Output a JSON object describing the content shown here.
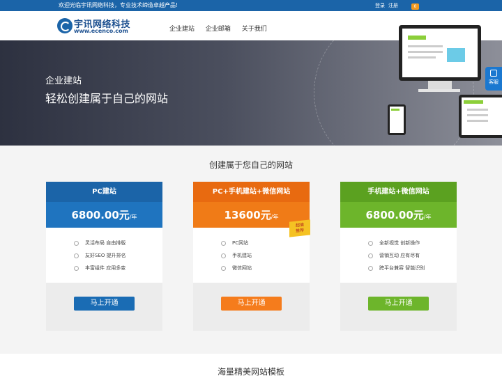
{
  "topbar": {
    "welcome": "欢迎光临宇讯网络科技，专业技术缔造卓越产品!",
    "login": "登录",
    "register": "注册",
    "cart_count": "0",
    "colors": {
      "bar": "#1b64a8",
      "cart": "#f39a1f"
    }
  },
  "header": {
    "logo_cn": "宇讯网络科技",
    "logo_en": "www.ecenco.com",
    "nav": [
      "企业建站",
      "企业邮箱",
      "关于我们"
    ]
  },
  "banner": {
    "subtitle": "企业建站",
    "title": "轻松创建属于自己的网站",
    "service_label": "客服"
  },
  "pricing": {
    "title": "创建属于您自己的网站",
    "badge": [
      "超值",
      "推荐"
    ],
    "plans": [
      {
        "name": "PC建站",
        "price": "6800.00",
        "currency": "元",
        "period": "/年",
        "features": [
          "灵活布局 自由排版",
          "友好SEO 提升排名",
          "丰富组件 应用多变"
        ],
        "button": "马上开通",
        "color": "#1b64a8"
      },
      {
        "name": "PC+手机建站+微信网站",
        "price": "13600",
        "currency": "元",
        "period": "/年",
        "features": [
          "PC网站",
          "手机建站",
          "微信网站"
        ],
        "button": "马上开通",
        "color": "#f07b17"
      },
      {
        "name": "手机建站+微信网站",
        "price": "6800.00",
        "currency": "元",
        "period": "/年",
        "features": [
          "全新视觉 创新操作",
          "营销互动 应有尽有",
          "跨平台兼容 智能识别"
        ],
        "button": "马上开通",
        "color": "#6db52b"
      }
    ]
  },
  "templates": {
    "title": "海量精美网站模板"
  }
}
